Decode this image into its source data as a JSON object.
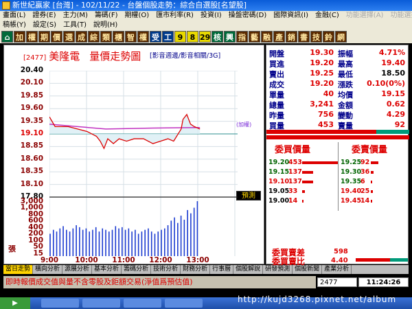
{
  "window": {
    "title": "新世紀贏家 [台灣] - 102/11/22 - 台盤個股走勢：綜合自選股[名望股]"
  },
  "menu": {
    "row1": [
      "畫面(L)",
      "證券(E)",
      "主力(M)",
      "籌碼(F)",
      "期權(O)",
      "匯市利率(R)",
      "投資(I)",
      "操盤密碼(D)",
      "國際資訊(I)",
      "金融(C)",
      "功能選擇(A)",
      "功能選擇(B)"
    ],
    "row2": [
      "稿帳(Y)",
      "設定(S)",
      "工具(T)",
      "說明(H)"
    ]
  },
  "toolbar": {
    "buttons": [
      "加",
      "權",
      "期",
      "價",
      "選",
      "成",
      "綜",
      "類",
      "櫃",
      "智",
      "權",
      "受",
      "工",
      "9",
      "8",
      "29",
      "核",
      "興",
      "指",
      "藝",
      "融",
      "產",
      "銷",
      "書",
      "技",
      "鈴",
      "網"
    ]
  },
  "chart": {
    "code": "[2477]",
    "name": "美隆電",
    "title": "量價走勢圖",
    "links": "[影音週邊/影音相關/3G]",
    "ref_caption": "(加權)",
    "predict_label": "預測",
    "volume_unit": "張",
    "price_ticks": [
      "20.40",
      "20.10",
      "19.85",
      "19.60",
      "19.35",
      "19.10",
      "18.85",
      "18.60",
      "18.35",
      "18.10",
      "17.80"
    ],
    "volume_ticks": [
      "3,000",
      "1,000",
      "800",
      "600",
      "400",
      "200",
      "100",
      "50",
      "15"
    ],
    "time_ticks": [
      "9:00",
      "10:00",
      "11:00",
      "12:00",
      "13:00"
    ]
  },
  "chart_data": {
    "type": "line",
    "x_label": "",
    "ylim": [
      17.8,
      20.4
    ],
    "reference": 19.1,
    "price_series": {
      "name": "",
      "points": [
        [
          0.0,
          19.45
        ],
        [
          0.03,
          19.25
        ],
        [
          0.1,
          19.25
        ],
        [
          0.15,
          19.2
        ],
        [
          0.2,
          19.15
        ],
        [
          0.25,
          19.05
        ],
        [
          0.27,
          18.95
        ],
        [
          0.29,
          18.8
        ],
        [
          0.31,
          19.0
        ],
        [
          0.34,
          18.9
        ],
        [
          0.37,
          19.0
        ],
        [
          0.41,
          18.95
        ],
        [
          0.45,
          19.0
        ],
        [
          0.5,
          19.0
        ],
        [
          0.55,
          18.9
        ],
        [
          0.59,
          18.95
        ],
        [
          0.63,
          19.0
        ],
        [
          0.66,
          18.95
        ],
        [
          0.7,
          19.2
        ],
        [
          0.71,
          19.4
        ],
        [
          0.73,
          19.5
        ],
        [
          0.75,
          19.3
        ],
        [
          0.77,
          19.25
        ],
        [
          0.8,
          19.2
        ]
      ]
    },
    "avg_series": {
      "name": "",
      "points": [
        [
          0.0,
          19.3
        ],
        [
          0.3,
          19.2
        ],
        [
          0.55,
          19.22
        ],
        [
          0.8,
          19.23
        ]
      ]
    },
    "volume": [
      15,
      25,
      20,
      30,
      40,
      25,
      20,
      30,
      45,
      35,
      25,
      30,
      20,
      25,
      35,
      20,
      30,
      25,
      20,
      25,
      40,
      30,
      35,
      25,
      30,
      20,
      25,
      15,
      20,
      25,
      30,
      20,
      15,
      20,
      25,
      30,
      45,
      80,
      120,
      60,
      150,
      90,
      300,
      200,
      400,
      900
    ]
  },
  "quote": {
    "rows": [
      {
        "l": "開盤",
        "v": "19.30",
        "r": "振幅",
        "w": "4.71%",
        "wc": "#d00"
      },
      {
        "l": "買進",
        "v": "19.20",
        "r": "最高",
        "w": "19.40",
        "wc": "#d00"
      },
      {
        "l": "賣出",
        "v": "19.25",
        "r": "最低",
        "w": "18.50",
        "wc": "#000"
      },
      {
        "l": "成交",
        "v": "19.20",
        "r": "漲跌",
        "w": "0.10(0%)",
        "wc": "#d00"
      },
      {
        "l": "單量",
        "v": "40",
        "r": "均價",
        "w": "19.15",
        "wc": "#d00"
      },
      {
        "l": "總量",
        "v": "3,241",
        "r": "金額",
        "w": "0.62",
        "wc": "#d00"
      },
      {
        "l": "昨量",
        "v": "756",
        "r": "變動",
        "w": "4.29",
        "wc": "#d00"
      },
      {
        "l": "買量",
        "v": "453",
        "r": "賣量",
        "w": "92",
        "wc": "#d00"
      }
    ],
    "value_colors": [
      "#d00",
      "#d00",
      "#d00",
      "#d00",
      "#d00",
      "#d00",
      "#d00",
      "#d00"
    ],
    "buy_head": "委買價量",
    "sell_head": "委賣價量",
    "bids": [
      [
        "19.20",
        "453"
      ],
      [
        "19.15",
        "137"
      ],
      [
        "19.10",
        "137"
      ],
      [
        "19.05",
        "33"
      ],
      [
        "19.00",
        "14"
      ]
    ],
    "asks": [
      [
        "19.25",
        "92"
      ],
      [
        "19.30",
        "36"
      ],
      [
        "19.35",
        "6"
      ],
      [
        "19.40",
        "25"
      ],
      [
        "19.45",
        "14"
      ]
    ],
    "bid_colors": [
      "#d00",
      "#d00",
      "#d00",
      "#d00",
      "#d00"
    ],
    "ask_colors": [
      "#d00",
      "#d00",
      "#d00",
      "#d00",
      "#d00"
    ],
    "bid_price_colors": [
      "#006400",
      "#006400",
      "#d00",
      "#000",
      "#000"
    ],
    "ask_price_colors": [
      "#006400",
      "#006400",
      "#006400",
      "#d00",
      "#d00"
    ],
    "diff_label": "委買賣差",
    "diff_value": "598",
    "ratio_label": "委買賣比",
    "ratio_value": "4.40"
  },
  "tabs": [
    "當日走勢",
    "橫向分析",
    "源展分析",
    "基本分析",
    "籌碼分析",
    "技術分析",
    "財務分析",
    "行事曆",
    "個股解說",
    "研發預測",
    "個股新聞",
    "產業分析"
  ],
  "status": {
    "ticker": "即時報價成交值與量不含零股及鉅額交易(淨值爲預估值)",
    "code": "2477",
    "time": "11:24:26"
  },
  "taskbar": {
    "url": "http://kujd3268.pixnet.net/album"
  },
  "colors": {
    "accent_red": "#d00",
    "navy": "#00008b",
    "price_line": "#d00",
    "avg_line": "#c030c0"
  }
}
